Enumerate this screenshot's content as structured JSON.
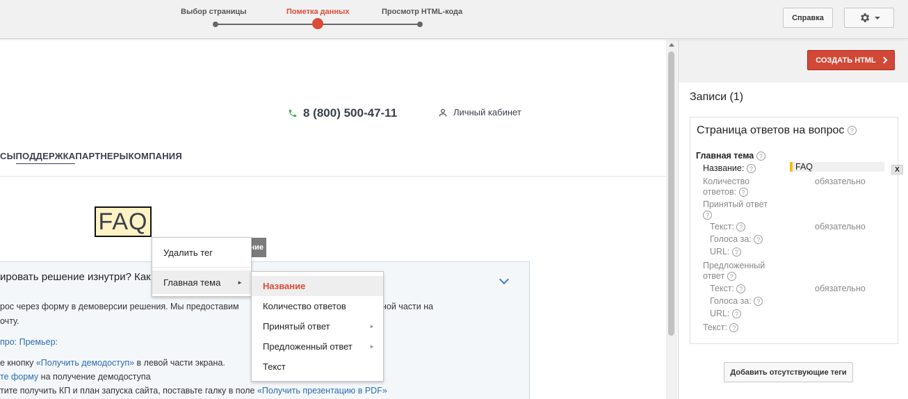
{
  "steps": [
    {
      "label": "Выбор страницы"
    },
    {
      "label": "Пометка данных"
    },
    {
      "label": "Просмотр HTML-кода"
    }
  ],
  "header": {
    "help_label": "Справка",
    "settings_icon": "gear-icon"
  },
  "site": {
    "phone": "8 (800) 500-47-11",
    "cabinet": "Личный кабинет",
    "nav": [
      "СЫ",
      "ПОДДЕРЖКА",
      "ПАРТНЕРЫ",
      "КОМПАНИЯ"
    ],
    "faq_title": "FAQ",
    "tag_tail": "ние",
    "accordion_title": "ировать решение изнутри? Как",
    "para1": "рос через форму в демоверсии решения. Мы предоставим",
    "para1_tail": "ной части на",
    "para2": "очту.",
    "link_premier": "про: Премьер:",
    "line3_pre": "е кнопку ",
    "line3_link": "«Получить демодоступ»",
    "line3_post": " в левой части экрана.",
    "line4_link": "те форму",
    "line4_post": " на получение демодоступа",
    "line5_pre": "тите получить КП и план запуска сайта, поставьте галку в поле ",
    "line5_link": "«Получить презентацию в PDF»"
  },
  "context_menu": {
    "remove_tag": "Удалить тег",
    "main_topic": "Главная тема",
    "submenu": [
      "Название",
      "Количество ответов",
      "Принятый ответ",
      "Предложенный ответ",
      "Текст"
    ]
  },
  "panel": {
    "create_html": "СОЗДАТЬ HTML",
    "records_title": "Записи (1)",
    "card_title": "Страница ответов на вопрос",
    "main_topic": "Главная тема",
    "name_label": "Название:",
    "name_value": "FAQ",
    "remove": "X",
    "answer_count": "Количество\nответов:",
    "accepted_answer": "Принятый ответ",
    "text_label": "Текст:",
    "upvotes_label": "Голоса за:",
    "url_label": "URL:",
    "suggested_answer": "Предложенный\nответ",
    "required": "обязательно",
    "add_missing": "Добавить отсутствующие теги"
  },
  "colors": {
    "accent": "#dd4b39",
    "highlight": "#fff2c4",
    "tag_marker": "#f4c20d",
    "link": "#2b6cb0",
    "phone_icon": "#4caf50"
  }
}
